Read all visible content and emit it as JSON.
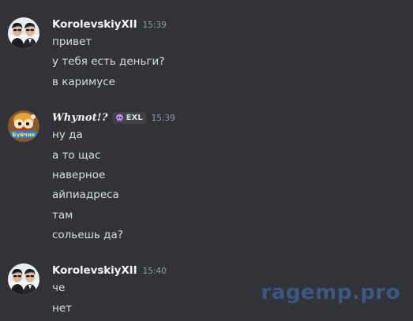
{
  "messages": [
    {
      "username": "KorolevskiyXII",
      "time": "15:39",
      "lines": [
        "привет",
        "у тебя есть деньги?",
        "в каримусе"
      ]
    },
    {
      "username": "Whynot!?",
      "time": "15:39",
      "tag": {
        "icon": "skull-icon",
        "label": "EXL"
      },
      "lines": [
        "ну да",
        "а то щас",
        "наверное",
        "айпиадреса",
        "там",
        "сольешь да?"
      ]
    },
    {
      "username": "KorolevskiyXII",
      "time": "15:40",
      "lines": [
        "че",
        "нет"
      ]
    }
  ],
  "watermark": "ragemp.pro",
  "colors": {
    "background": "#313338",
    "text": "#dbdee1",
    "username": "#f2f3f5",
    "timestamp": "#949ba4",
    "tag_bg": "#3f4147",
    "watermark": "#3d5b8a"
  }
}
